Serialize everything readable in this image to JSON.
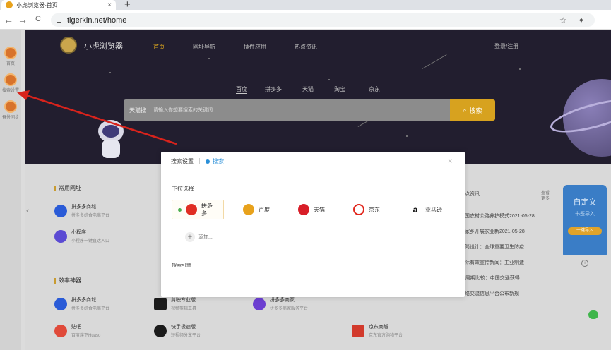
{
  "browser": {
    "tab_title": "小虎浏览器-首页",
    "tab_close": "×",
    "new_tab": "+",
    "url": "tigerkin.net/home",
    "back": "←",
    "forward": "→",
    "reload": "C",
    "toolbar_icons": "☆ ✦"
  },
  "rail": {
    "items": [
      {
        "label": "首页",
        "icon": "home-icon"
      },
      {
        "label": "搜索设置",
        "icon": "search-settings-icon"
      },
      {
        "label": "备份同步",
        "icon": "backup-sync-icon"
      }
    ]
  },
  "header": {
    "brand": "小虎浏览器",
    "nav": [
      "首页",
      "网址导航",
      "插件应用",
      "热点资讯"
    ],
    "login": "登录/注册"
  },
  "search": {
    "tabs": [
      "百度",
      "拼多多",
      "天猫",
      "淘宝",
      "京东"
    ],
    "active_tab": 0,
    "engine": "天猫搜",
    "placeholder": "请输入你想要搜索的关键词",
    "button": "搜索"
  },
  "sections": {
    "common": {
      "title": "常用网址",
      "sites": [
        {
          "name": "拼多多商城",
          "desc": "拼多多综合电商平台",
          "color": "#2a5bd7"
        },
        {
          "name": "小程序",
          "desc": "小程序一键直达入口",
          "color": "#5b4bd3"
        }
      ]
    },
    "tools": {
      "title": "效率神器",
      "sites": [
        {
          "name": "拼多多商城",
          "desc": "拼多多综合电商平台",
          "color": "#2a5bd7"
        },
        {
          "name": "贴吧",
          "desc": "百度旗下Huaso",
          "color": "#e04a3a"
        },
        {
          "name": "剪映专业版",
          "desc": "视频剪辑工具",
          "color": "#1b1b1b"
        },
        {
          "name": "拼多多商家",
          "desc": "拼多多商家服务平台",
          "color": "#6c3fd1"
        },
        {
          "name": "快手极速版",
          "desc": "短视频分享平台",
          "color": "#1b1b1b"
        },
        {
          "name": "京东商城",
          "desc": "京东官方购物平台",
          "color": "#d23a2c"
        }
      ]
    }
  },
  "hot": {
    "title": "热点资讯",
    "more": "查看更多",
    "items": [
      "我国农村公路养护模式2021-05-28",
      "以家乡开展农业新2021-05-28",
      "精简设计：全球重要卫生防疫",
      "国际有效宣传新闻：工业制造",
      "14周期比较：中国交通获得",
      "网络交流信息平台公布新规"
    ]
  },
  "promo": {
    "big": "自定义",
    "sub": "书签导入",
    "cta": "一键导入"
  },
  "modal": {
    "title": "搜索设置",
    "tab": "搜索",
    "close": "×",
    "section_label": "下拉选择",
    "options": [
      {
        "name": "拼多多",
        "color": "#e02e24",
        "selected": true
      },
      {
        "name": "百度",
        "color": "#e8a21c",
        "selected": false
      },
      {
        "name": "天猫",
        "color": "#d81e28",
        "selected": false
      },
      {
        "name": "京东",
        "color": "#e1251b",
        "selected": false
      },
      {
        "name": "亚马逊",
        "color": "#111111",
        "selected": false
      }
    ],
    "add_label": "添加...",
    "add_icon": "+",
    "footer_label": "搜索引擎"
  }
}
